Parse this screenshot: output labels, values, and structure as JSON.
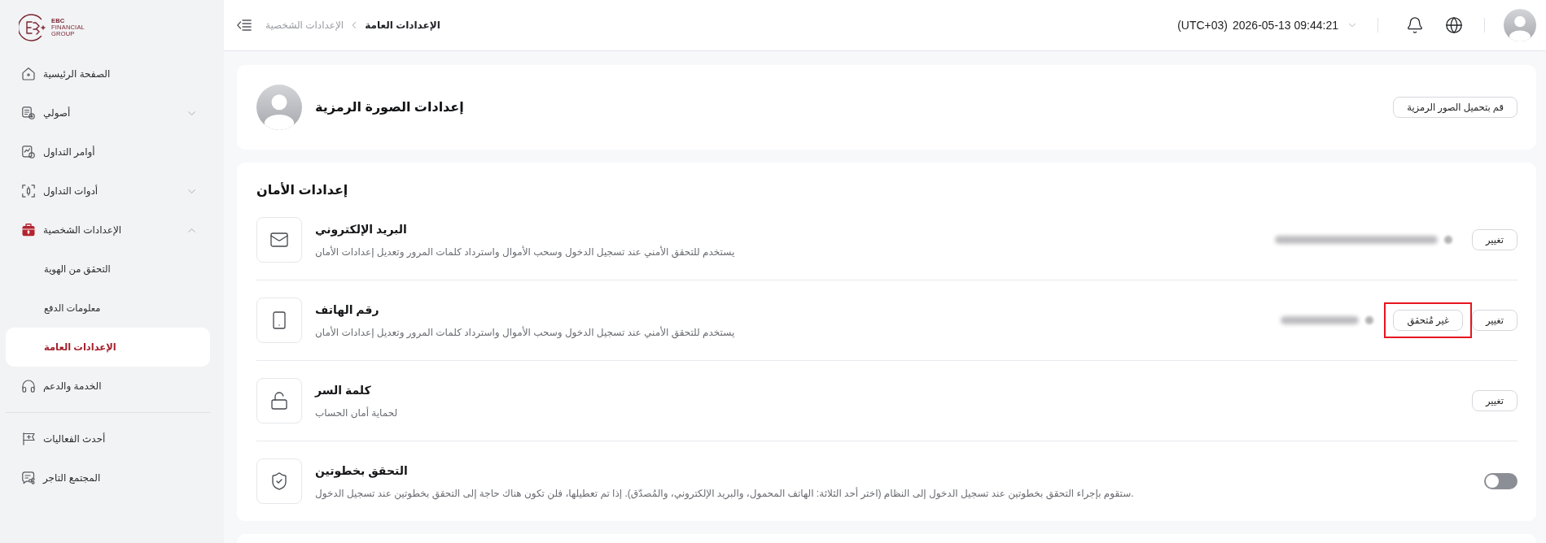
{
  "sidebar": {
    "logo": {
      "lines": [
        "EBC",
        "FINANCIAL",
        "GROUP"
      ]
    },
    "sections": [
      {
        "items": [
          {
            "label": "الصفحة الرئيسية",
            "selected": false
          },
          {
            "label": "أصولي",
            "selected": false,
            "expanded": false
          },
          {
            "label": "أوامر التداول",
            "selected": false
          },
          {
            "label": "أدوات التداول",
            "selected": false,
            "expanded": false
          },
          {
            "label": "الإعدادات الشخصية",
            "selected": false,
            "expanded": true,
            "children": [
              {
                "label": "التحقق من الهوية",
                "selected": false
              },
              {
                "label": "معلومات الدفع",
                "selected": false
              },
              {
                "label": "الإعدادات العامة",
                "selected": true
              }
            ]
          },
          {
            "label": "الخدمة والدعم",
            "selected": false
          }
        ]
      },
      {
        "items": [
          {
            "label": "أحدث الفعاليات",
            "selected": false
          },
          {
            "label": "المجتمع التاجر",
            "selected": false
          }
        ]
      }
    ]
  },
  "header": {
    "breadcrumb": [
      {
        "label": "الإعدادات العامة",
        "current": true
      },
      {
        "label": "الإعدادات الشخصية",
        "current": false
      }
    ],
    "timezone": "(UTC+03)",
    "datetime": "2026-05-13 09:44:21"
  },
  "avatar_settings": {
    "title": "إعدادات الصورة الرمزية",
    "upload_button": "قم بتحميل الصور الرمزية"
  },
  "security_settings": {
    "title": "إعدادات الأمان",
    "items": [
      {
        "kind": "action",
        "title": "البريد الإلكتروني",
        "description": "يستخدم للتحقق الأمني عند تسجيل الدخول وسحب الأموال واسترداد كلمات المرور وتعديل إعدادات الأمان",
        "masked": true,
        "action": "تغيير"
      },
      {
        "kind": "action",
        "title": "رقم الهاتف",
        "description": "يستخدم للتحقق الأمني عند تسجيل الدخول وسحب الأموال واسترداد كلمات المرور وتعديل إعدادات الأمان",
        "masked": true,
        "status": {
          "label": "غير مُتحقق",
          "highlighted": true
        },
        "action": "تغيير"
      },
      {
        "kind": "action",
        "title": "كلمة السر",
        "description": "لحماية أمان الحساب",
        "masked": false,
        "action": "تغيير"
      },
      {
        "kind": "switch",
        "title": "التحقق بخطوتين",
        "description": "ستقوم بإجراء التحقق بخطوتين عند تسجيل الدخول إلى النظام (اختر أحد الثلاثة: الهاتف المحمول، والبريد الإلكتروني، والمُصدّق). إذا تم تعطيلها، فلن تكون هناك حاجة إلى التحقق بخطوتين عند تسجيل الدخول.",
        "masked": false,
        "on": false
      }
    ]
  }
}
